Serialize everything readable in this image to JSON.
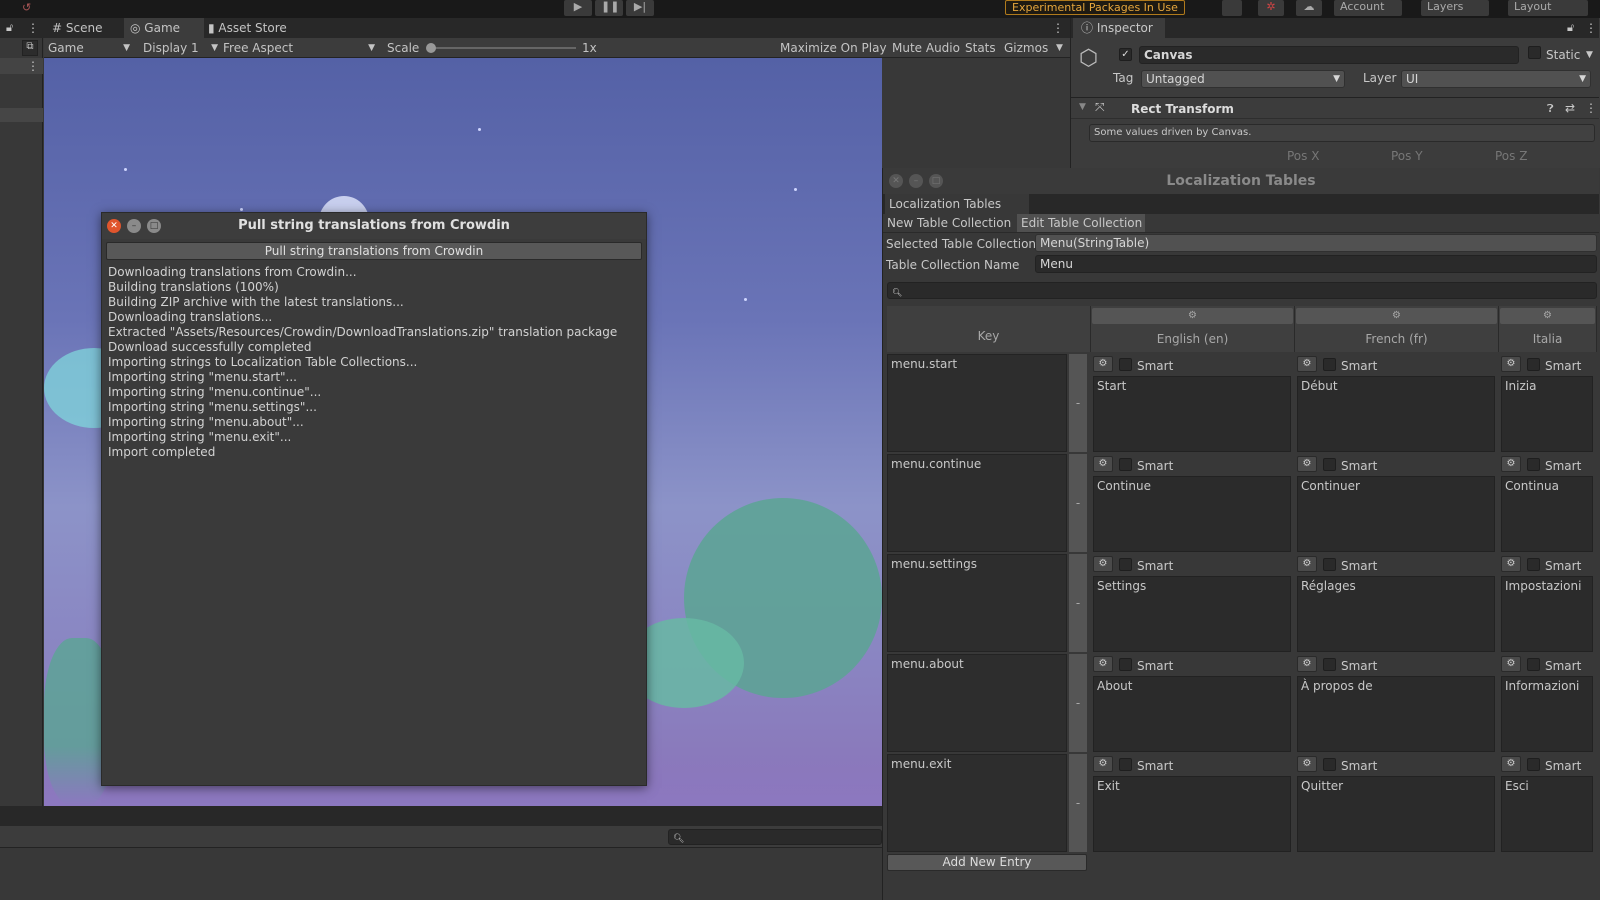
{
  "toolbar": {
    "experimental": "Experimental Packages In Use",
    "account": "Account",
    "layers": "Layers",
    "layout": "Layout"
  },
  "tabs": {
    "scene": "Scene",
    "game": "Game",
    "asset_store": "Asset Store"
  },
  "game_toolbar": {
    "mode": "Game",
    "display": "Display 1",
    "aspect": "Free Aspect",
    "scale_label": "Scale",
    "scale_value": "1x",
    "maximize": "Maximize On Play",
    "mute": "Mute Audio",
    "stats": "Stats",
    "gizmos": "Gizmos"
  },
  "inspector": {
    "tab": "Inspector",
    "object_name": "Canvas",
    "static": "Static",
    "tag_label": "Tag",
    "tag_value": "Untagged",
    "layer_label": "Layer",
    "layer_value": "UI",
    "component": "Rect Transform",
    "note": "Some values driven by Canvas.",
    "pos_x": "Pos X",
    "pos_y": "Pos Y",
    "pos_z": "Pos Z"
  },
  "dialog": {
    "title": "Pull string translations from Crowdin",
    "button": "Pull string translations from Crowdin",
    "log": [
      "Downloading translations from Crowdin...",
      "Building translations (100%)",
      "Building ZIP archive with the latest translations...",
      "Downloading translations...",
      "Extracted \"Assets/Resources/Crowdin/DownloadTranslations.zip\" translation package",
      "Download successfully completed",
      "Importing strings to Localization Table Collections...",
      "Importing string \"menu.start\"...",
      "Importing string \"menu.continue\"...",
      "Importing string \"menu.settings\"...",
      "Importing string \"menu.about\"...",
      "Importing string \"menu.exit\"...",
      "Import completed"
    ]
  },
  "loc": {
    "title": "Localization Tables",
    "tab": "Localization Tables",
    "new_tab": "New Table Collection",
    "edit_tab": "Edit Table Collection",
    "selected_label": "Selected Table Collection",
    "selected_value": "Menu(StringTable)",
    "name_label": "Table Collection Name",
    "name_value": "Menu",
    "key_header": "Key",
    "languages": [
      "English (en)",
      "French (fr)",
      "Italia"
    ],
    "smart": "Smart",
    "collapse": "-",
    "add_entry": "Add New Entry",
    "rows": [
      {
        "key": "menu.start",
        "values": [
          "Start",
          "Début",
          "Inizia"
        ]
      },
      {
        "key": "menu.continue",
        "values": [
          "Continue",
          "Continuer",
          "Continua"
        ]
      },
      {
        "key": "menu.settings",
        "values": [
          "Settings",
          "Réglages",
          "Impostazioni"
        ]
      },
      {
        "key": "menu.about",
        "values": [
          "About",
          "À propos de",
          "Informazioni"
        ]
      },
      {
        "key": "menu.exit",
        "values": [
          "Exit",
          "Quitter",
          "Esci"
        ]
      }
    ]
  }
}
